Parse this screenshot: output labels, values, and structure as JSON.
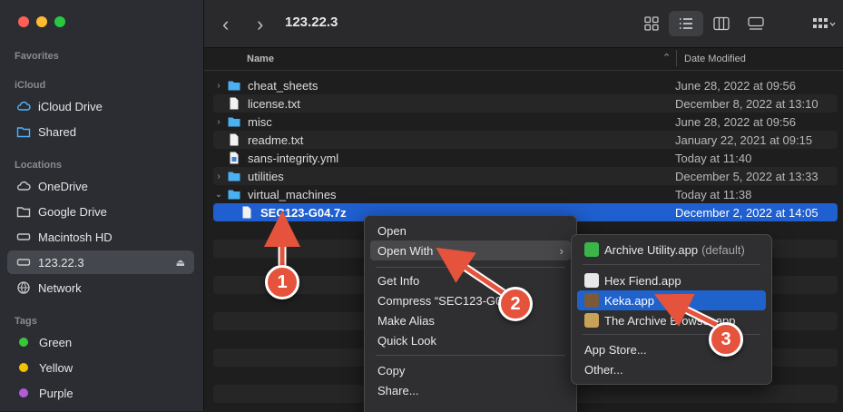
{
  "window": {
    "title": "123.22.3"
  },
  "sidebar": {
    "favorites_label": "Favorites",
    "icloud_label": "iCloud",
    "icloud_items": [
      {
        "label": "iCloud Drive"
      },
      {
        "label": "Shared"
      }
    ],
    "locations_label": "Locations",
    "locations": [
      {
        "label": "OneDrive"
      },
      {
        "label": "Google Drive"
      },
      {
        "label": "Macintosh HD"
      },
      {
        "label": "123.22.3"
      },
      {
        "label": "Network"
      }
    ],
    "tags_label": "Tags",
    "tags": [
      {
        "label": "Green",
        "color": "#3bc53b"
      },
      {
        "label": "Yellow",
        "color": "#f3c300"
      },
      {
        "label": "Purple",
        "color": "#b45cd8"
      }
    ],
    "selected": "123.22.3"
  },
  "columns": {
    "name": "Name",
    "date": "Date Modified"
  },
  "files": [
    {
      "name": "cheat_sheets",
      "date": "June 28, 2022 at 09:56",
      "kind": "folder"
    },
    {
      "name": "license.txt",
      "date": "December 8, 2022 at 13:10",
      "kind": "file"
    },
    {
      "name": "misc",
      "date": "June 28, 2022 at 09:56",
      "kind": "folder"
    },
    {
      "name": "readme.txt",
      "date": "January 22, 2021 at 09:15",
      "kind": "file"
    },
    {
      "name": "sans-integrity.yml",
      "date": "Today at 11:40",
      "kind": "file"
    },
    {
      "name": "utilities",
      "date": "December 5, 2022 at 13:33",
      "kind": "folder"
    },
    {
      "name": "virtual_machines",
      "date": "Today at 11:38",
      "kind": "folder-open"
    },
    {
      "name": "SEC123-G04.7z",
      "date": "December 2, 2022 at 14:05",
      "kind": "file",
      "selected": true
    }
  ],
  "context_menu": {
    "open": "Open",
    "open_with": "Open With",
    "get_info": "Get Info",
    "compress": "Compress “SEC123-G0",
    "make_alias": "Make Alias",
    "quick_look": "Quick Look",
    "copy": "Copy",
    "share": "Share..."
  },
  "submenu": {
    "archive_utility": "Archive Utility.app",
    "default_tag": "(default)",
    "hex_fiend": "Hex Fiend.app",
    "keka": "Keka.app",
    "unarchiver": "The Archive Browser.app",
    "app_store": "App Store...",
    "other": "Other..."
  },
  "callouts": [
    "1",
    "2",
    "3"
  ],
  "colors": {
    "accent": "#1f62cc",
    "callout": "#e5533d"
  }
}
